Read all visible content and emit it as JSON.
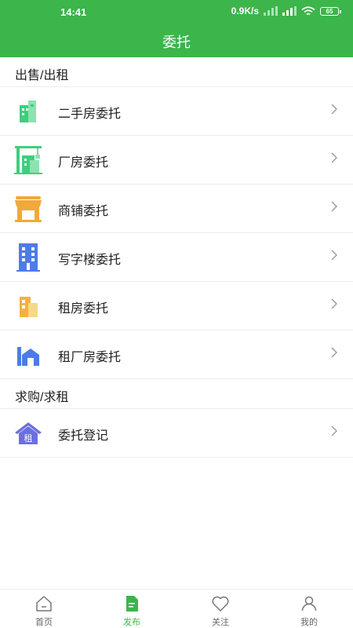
{
  "status_bar": {
    "time": "14:41",
    "net_speed": "0.9K/s",
    "battery": "65"
  },
  "header": {
    "title": "委托"
  },
  "colors": {
    "primary": "#3cb54a",
    "icon_green": "#3ecf7d",
    "icon_orange": "#f0a93a",
    "icon_blue": "#4d7ce8",
    "icon_gold": "#f2b33d",
    "icon_purple": "#6b6fe0",
    "divider": "#ececec"
  },
  "sections": {
    "sell_rent": {
      "title": "出售/出租",
      "items": [
        {
          "label": "二手房委托",
          "icon": "building-icon"
        },
        {
          "label": "厂房委托",
          "icon": "factory-crane-icon"
        },
        {
          "label": "商铺委托",
          "icon": "storefront-icon"
        },
        {
          "label": "写字楼委托",
          "icon": "office-tower-icon"
        },
        {
          "label": "租房委托",
          "icon": "rental-building-icon"
        },
        {
          "label": "租厂房委托",
          "icon": "warehouse-icon"
        }
      ]
    },
    "buy_rent": {
      "title": "求购/求租",
      "items": [
        {
          "label": "委托登记",
          "icon": "house-rent-icon",
          "badge": "租"
        }
      ]
    }
  },
  "tab_bar": {
    "active": "发布",
    "tabs": [
      {
        "label": "首页",
        "icon": "home-icon"
      },
      {
        "label": "发布",
        "icon": "document-icon"
      },
      {
        "label": "关注",
        "icon": "heart-icon"
      },
      {
        "label": "我的",
        "icon": "user-icon"
      }
    ]
  }
}
